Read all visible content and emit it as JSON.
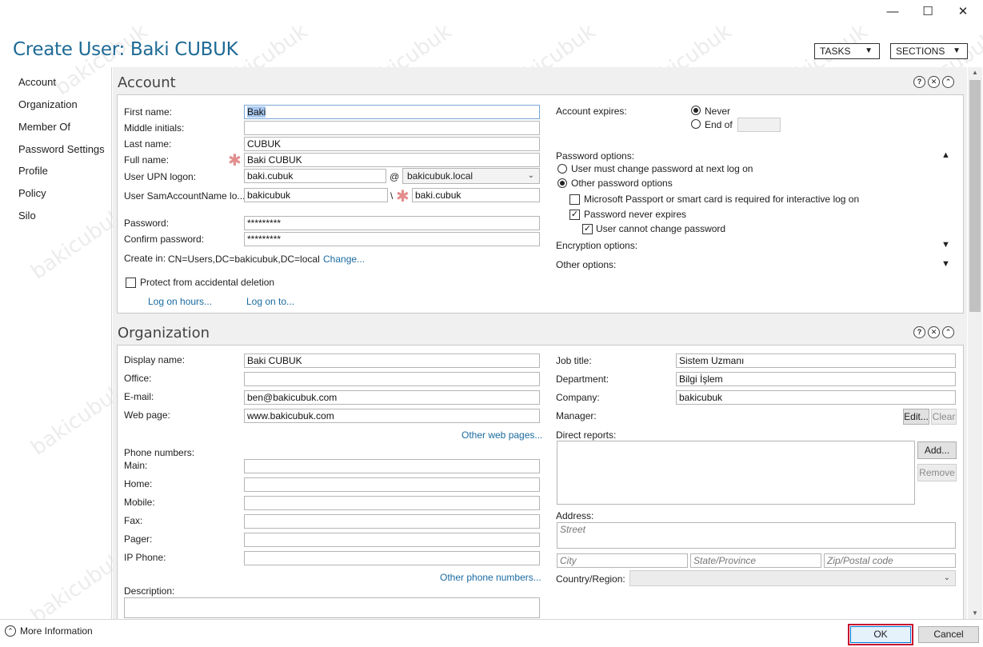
{
  "window": {
    "title": "Create User: Baki CUBUK",
    "min_icon": "minimize-icon",
    "max_icon": "maximize-icon",
    "close_icon": "close-icon"
  },
  "top_buttons": {
    "tasks": "TASKS",
    "sections": "SECTIONS"
  },
  "nav": [
    "Account",
    "Organization",
    "Member Of",
    "Password Settings",
    "Profile",
    "Policy",
    "Silo"
  ],
  "account": {
    "title": "Account",
    "first_name_label": "First name:",
    "first_name": "Baki",
    "middle_initials_label": "Middle initials:",
    "middle_initials": "",
    "last_name_label": "Last name:",
    "last_name": "CUBUK",
    "full_name_label": "Full name:",
    "full_name": "Baki CUBUK",
    "upn_label": "User UPN logon:",
    "upn": "baki.cubuk",
    "at": "@",
    "upn_domain": "bakicubuk.local",
    "sam_label": "User SamAccountName lo...",
    "sam_domain": "bakicubuk",
    "backslash": "\\",
    "sam": "baki.cubuk",
    "password_label": "Password:",
    "password": "*********",
    "confirm_label": "Confirm password:",
    "confirm": "*********",
    "create_in_label": "Create in:",
    "create_in": "CN=Users,DC=bakicubuk,DC=local",
    "change_link": "Change...",
    "protect_label": "Protect from accidental deletion",
    "protect_checked": false,
    "log_on_hours": "Log on hours...",
    "log_on_to": "Log on to...",
    "expires_label": "Account expires:",
    "never": "Never",
    "end_of": "End of",
    "end_of_value": "",
    "pw_options_label": "Password options:",
    "must_change": "User must change password at next log on",
    "other_pw": "Other password options",
    "smart_card": "Microsoft Passport or smart card is required for interactive log on",
    "smart_card_checked": false,
    "never_expires": "Password never expires",
    "never_expires_checked": true,
    "cannot_change": "User cannot change password",
    "cannot_change_checked": true,
    "encryption": "Encryption options:",
    "other_options": "Other options:"
  },
  "organization": {
    "title": "Organization",
    "display_name_label": "Display name:",
    "display_name": "Baki CUBUK",
    "office_label": "Office:",
    "office": "",
    "email_label": "E-mail:",
    "email": "ben@bakicubuk.com",
    "web_label": "Web page:",
    "web": "www.bakicubuk.com",
    "other_web": "Other web pages...",
    "phone_label": "Phone numbers:",
    "main_label": "Main:",
    "home_label": "Home:",
    "mobile_label": "Mobile:",
    "fax_label": "Fax:",
    "pager_label": "Pager:",
    "ip_label": "IP Phone:",
    "other_phone": "Other phone numbers...",
    "description_label": "Description:",
    "job_title_label": "Job title:",
    "job_title": "Sistem Uzmanı",
    "department_label": "Department:",
    "department": "Bilgi İşlem",
    "company_label": "Company:",
    "company": "bakicubuk",
    "manager_label": "Manager:",
    "edit_btn": "Edit...",
    "clear_btn": "Clear",
    "direct_reports_label": "Direct reports:",
    "add_btn": "Add...",
    "remove_btn": "Remove",
    "address_label": "Address:",
    "street_ph": "Street",
    "city_ph": "City",
    "state_ph": "State/Province",
    "zip_ph": "Zip/Postal code",
    "country_label": "Country/Region:"
  },
  "footer": {
    "more_info": "More Information",
    "ok": "OK",
    "cancel": "Cancel"
  },
  "watermark": "bakicubuk",
  "colors": {
    "title": "#1e6a95",
    "link": "#1a6aa0",
    "ok_border": "#c8102e"
  }
}
